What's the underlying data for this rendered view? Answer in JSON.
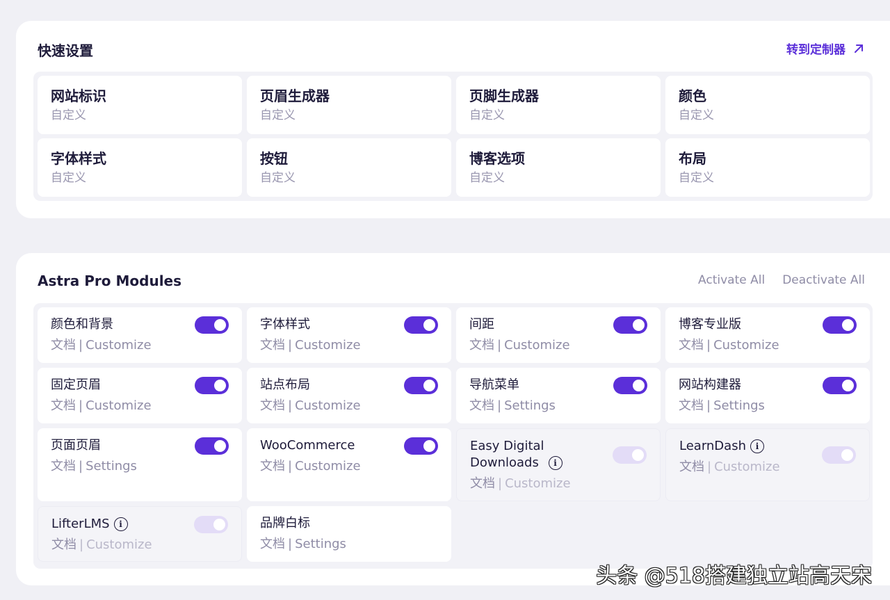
{
  "quick_settings": {
    "title": "快速设置",
    "customizer_link": "转到定制器",
    "items": [
      {
        "title": "网站标识",
        "sub": "自定义"
      },
      {
        "title": "页眉生成器",
        "sub": "自定义"
      },
      {
        "title": "页脚生成器",
        "sub": "自定义"
      },
      {
        "title": "颜色",
        "sub": "自定义"
      },
      {
        "title": "字体样式",
        "sub": "自定义"
      },
      {
        "title": "按钮",
        "sub": "自定义"
      },
      {
        "title": "博客选项",
        "sub": "自定义"
      },
      {
        "title": "布局",
        "sub": "自定义"
      }
    ]
  },
  "modules": {
    "title": "Astra Pro Modules",
    "activate_all": "Activate All",
    "deactivate_all": "Deactivate All",
    "doc_label": "文档",
    "separator": "|",
    "items": [
      {
        "name": "颜色和背景",
        "link": "Customize",
        "enabled": true
      },
      {
        "name": "字体样式",
        "link": "Customize",
        "enabled": true
      },
      {
        "name": "间距",
        "link": "Customize",
        "enabled": true
      },
      {
        "name": "博客专业版",
        "link": "Customize",
        "enabled": true
      },
      {
        "name": "固定页眉",
        "link": "Customize",
        "enabled": true
      },
      {
        "name": "站点布局",
        "link": "Customize",
        "enabled": true
      },
      {
        "name": "导航菜单",
        "link": "Settings",
        "enabled": true
      },
      {
        "name": "网站构建器",
        "link": "Settings",
        "enabled": true
      },
      {
        "name": "页面页眉",
        "link": "Settings",
        "enabled": true
      },
      {
        "name": "WooCommerce",
        "link": "Customize",
        "enabled": true
      },
      {
        "name": "Easy Digital\nDownloads",
        "link": "Customize",
        "enabled": false,
        "info": true
      },
      {
        "name": "LearnDash",
        "link": "Customize",
        "enabled": false,
        "info": true
      },
      {
        "name": "LifterLMS",
        "link": "Customize",
        "enabled": false,
        "info": true
      },
      {
        "name": "品牌白标",
        "link": "Settings",
        "enabled": null
      }
    ]
  },
  "watermark": "头条 @518搭建独立站高天宋",
  "colors": {
    "accent": "#5b2fd9",
    "toggle_off": "#e3dcf7",
    "muted": "#8f8ca6"
  }
}
